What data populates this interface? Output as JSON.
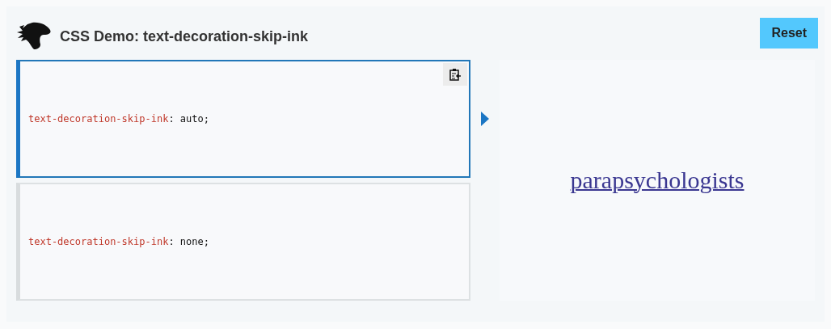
{
  "header": {
    "title": "CSS Demo: text-decoration-skip-ink",
    "reset_button": "Reset"
  },
  "examples": [
    {
      "code": "text-decoration-skip-ink: auto;",
      "selected": true
    },
    {
      "code": "text-decoration-skip-ink: none;",
      "selected": false
    }
  ],
  "preview": {
    "text": "parapsychologists"
  }
}
